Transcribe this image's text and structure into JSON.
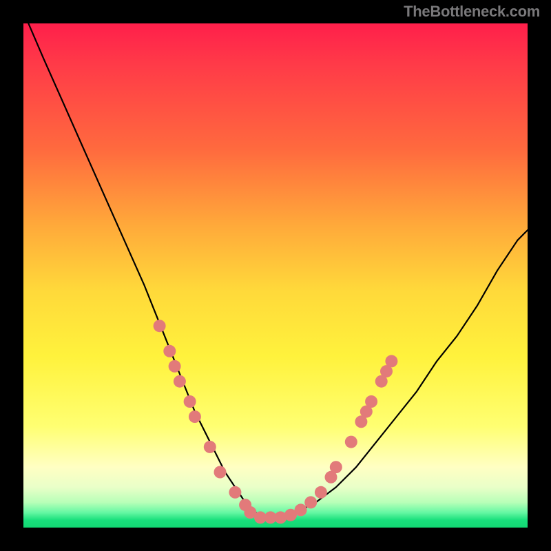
{
  "attribution": "TheBottleneck.com",
  "chart_data": {
    "type": "line",
    "title": "",
    "xlabel": "",
    "ylabel": "",
    "xlim": [
      0,
      100
    ],
    "ylim": [
      0,
      100
    ],
    "grid": false,
    "legend": false,
    "series": [
      {
        "name": "bottleneck-curve",
        "x": [
          1,
          4,
          8,
          12,
          16,
          20,
          24,
          26,
          28,
          30,
          32,
          34,
          36,
          38,
          40,
          42,
          44,
          46,
          48,
          50,
          54,
          58,
          62,
          66,
          70,
          74,
          78,
          82,
          86,
          90,
          94,
          98,
          100
        ],
        "y": [
          100,
          93,
          84,
          75,
          66,
          57,
          48,
          43,
          38,
          33,
          28,
          23,
          19,
          15,
          11,
          8,
          5,
          3,
          2,
          2,
          3,
          5,
          8,
          12,
          17,
          22,
          27,
          33,
          38,
          44,
          51,
          57,
          59
        ]
      }
    ],
    "markers": {
      "name": "highlighted-points",
      "color": "#e27a7a",
      "radius": 9,
      "points": [
        {
          "x": 27,
          "y": 40
        },
        {
          "x": 29,
          "y": 35
        },
        {
          "x": 30,
          "y": 32
        },
        {
          "x": 31,
          "y": 29
        },
        {
          "x": 33,
          "y": 25
        },
        {
          "x": 34,
          "y": 22
        },
        {
          "x": 37,
          "y": 16
        },
        {
          "x": 39,
          "y": 11
        },
        {
          "x": 42,
          "y": 7
        },
        {
          "x": 44,
          "y": 4.5
        },
        {
          "x": 45,
          "y": 3
        },
        {
          "x": 47,
          "y": 2
        },
        {
          "x": 49,
          "y": 2
        },
        {
          "x": 51,
          "y": 2
        },
        {
          "x": 53,
          "y": 2.5
        },
        {
          "x": 55,
          "y": 3.5
        },
        {
          "x": 57,
          "y": 5
        },
        {
          "x": 59,
          "y": 7
        },
        {
          "x": 61,
          "y": 10
        },
        {
          "x": 62,
          "y": 12
        },
        {
          "x": 65,
          "y": 17
        },
        {
          "x": 67,
          "y": 21
        },
        {
          "x": 68,
          "y": 23
        },
        {
          "x": 69,
          "y": 25
        },
        {
          "x": 71,
          "y": 29
        },
        {
          "x": 72,
          "y": 31
        },
        {
          "x": 73,
          "y": 33
        }
      ]
    }
  }
}
